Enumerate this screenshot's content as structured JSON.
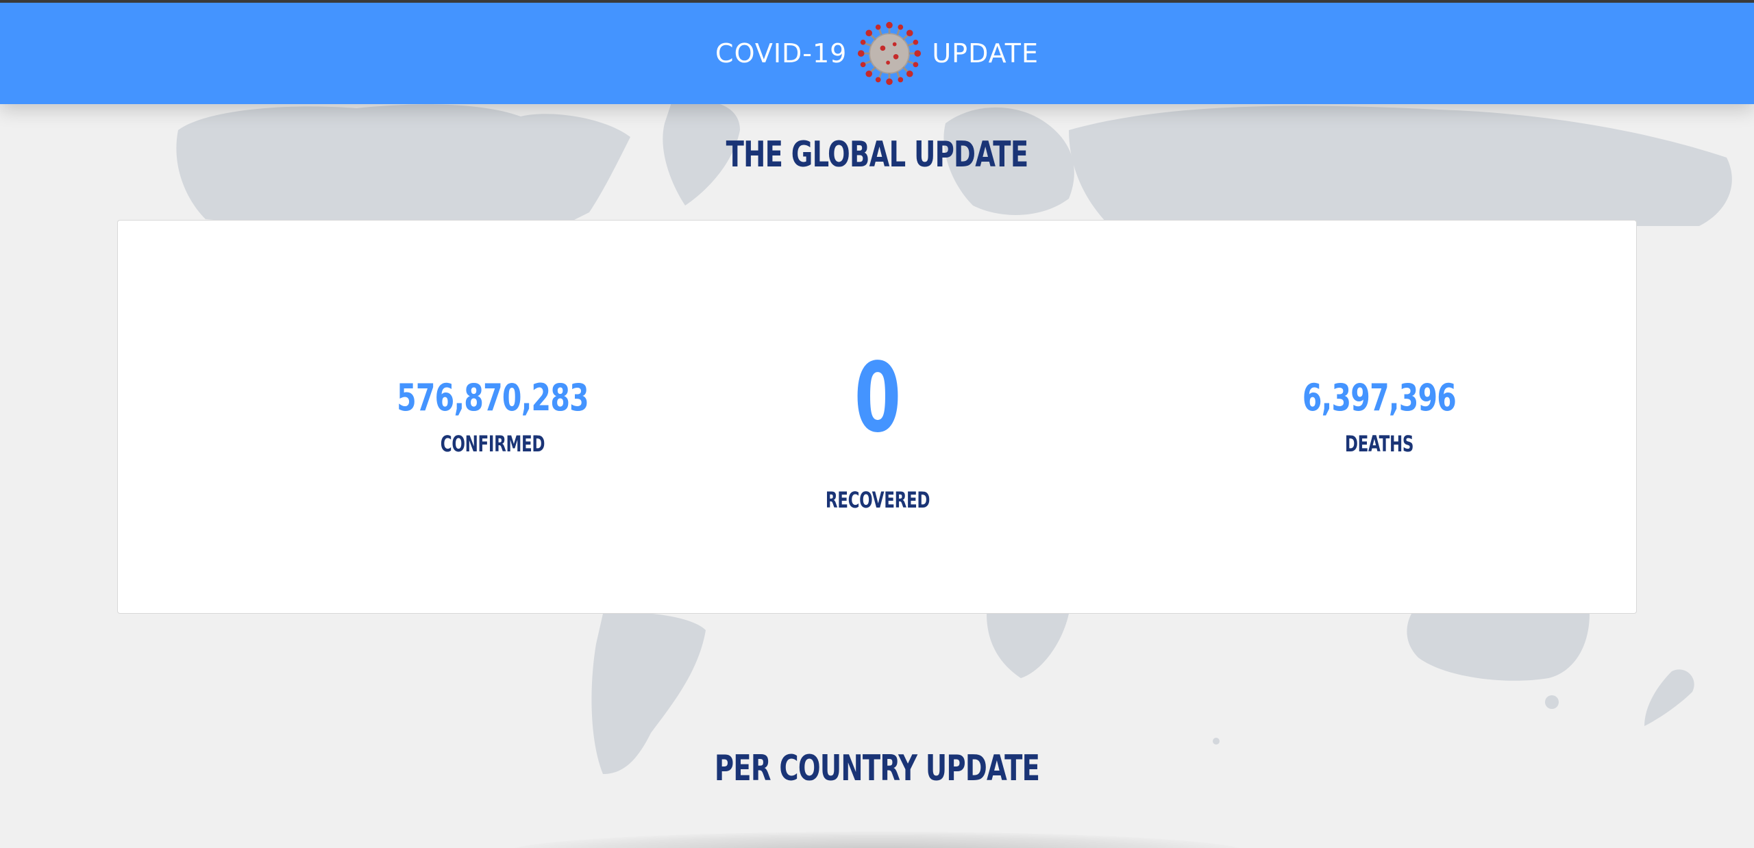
{
  "header": {
    "brand_left": "COVID-19",
    "brand_right": "UPDATE",
    "logo_icon": "coronavirus-icon",
    "background_color": "#4494ff"
  },
  "global": {
    "title": "THE GLOBAL UPDATE",
    "confirmed": {
      "value": "576,870,283",
      "label": "CONFIRMED"
    },
    "recovered": {
      "value": "0",
      "label": "RECOVERED"
    },
    "deaths": {
      "value": "6,397,396",
      "label": "DEATHS"
    }
  },
  "country": {
    "title": "PER COUNTRY UPDATE"
  },
  "colors": {
    "accent": "#4494ff",
    "heading": "#1a3476",
    "page_background": "#f0f0f0",
    "map_land": "#d3d7dc"
  }
}
